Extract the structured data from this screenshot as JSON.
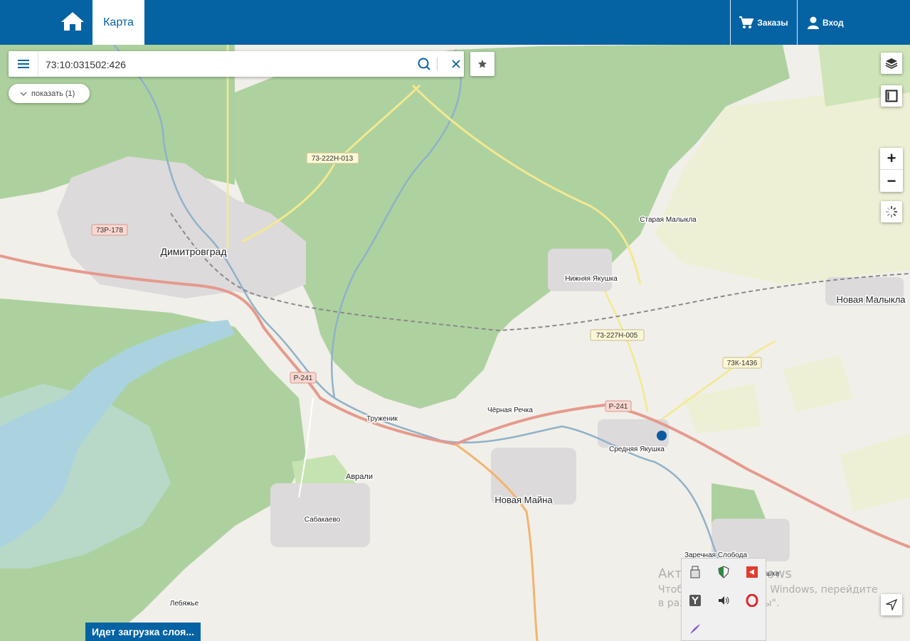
{
  "header": {
    "home_icon": "home-icon",
    "map_tab": "Карта",
    "orders": "Заказы",
    "login": "Вход",
    "colors": {
      "brand": "#0563a4"
    }
  },
  "search": {
    "value": "73:10:031502:426",
    "placeholder": ""
  },
  "show_button": "показать (1)",
  "zoom": {
    "in": "+",
    "out": "−"
  },
  "map": {
    "places": {
      "dimitrovgrad": "Димитровград",
      "staraya_malykla": "Старая Малыкла",
      "nizhnyaya_yakushka": "Нижняя Якушка",
      "novaya_malykla": "Новая Малыкла",
      "chernaya_rechka": "Чёрная Речка",
      "truzhenik": "Труженик",
      "srednyaya_yakushka": "Средняя Якушка",
      "avrali": "Аврали",
      "novaya_mayna": "Новая Майна",
      "sabakaevo": "Сабакаево",
      "zarechnaya_sloboda": "Заречная Слобода",
      "lebyazhe": "Лебяжье",
      "partial_yakushka": "шка"
    },
    "roads": {
      "r1": "73-222Н-013",
      "r2": "73Р-178",
      "r3": "73-227Н-005",
      "r4": "73К-1436",
      "r5": "Р-241",
      "r6": "Р-241"
    },
    "marker_color": "#0a5aa0"
  },
  "status": {
    "loading": "Идет загрузка слоя..."
  },
  "watermark": {
    "title": "Активация Windows",
    "text": "Чтобы активировать Windows, перейдите в раздел \"Параметры\"."
  }
}
